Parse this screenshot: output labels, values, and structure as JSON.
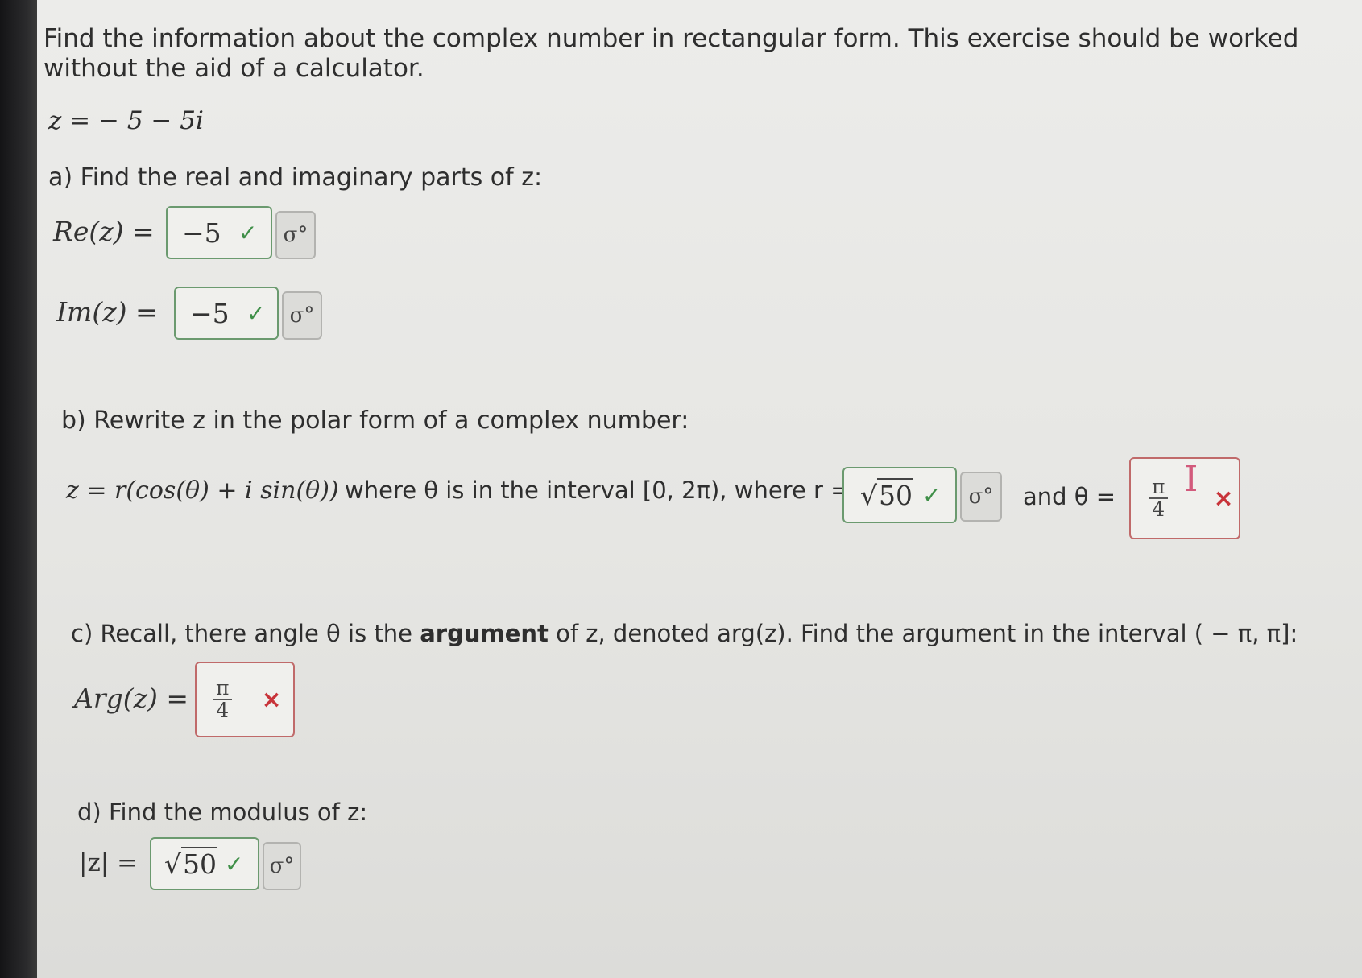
{
  "intro": "Find the information about the complex number in rectangular form. This exercise should be worked without the aid of a calculator.",
  "z_def": "z = − 5 − 5i",
  "part_a": {
    "prompt": "a) Find the real and imaginary parts of z:",
    "re_label": "Re(z) =",
    "re_value": "−5",
    "im_label": "Im(z) =",
    "im_value": "−5"
  },
  "part_b": {
    "prompt": "b) Rewrite z in the polar form of a complex number:",
    "formula": "z = r(cos(θ) + i sin(θ))",
    "where_theta": "where θ is in the interval [0, 2π), where r =",
    "r_value": "50",
    "and_theta": "and θ =",
    "theta_num": "π",
    "theta_den": "4"
  },
  "part_c": {
    "prompt_pre": "c) Recall, there angle θ is the ",
    "prompt_bold": "argument",
    "prompt_post": " of z, denoted arg(z). Find the argument in the interval ( − π, π]:",
    "arg_label": "Arg(z) =",
    "arg_num": "π",
    "arg_den": "4"
  },
  "part_d": {
    "prompt": "d) Find the modulus of z:",
    "mod_label": "|z| =",
    "mod_value": "50"
  },
  "icons": {
    "correct": "✓",
    "incorrect": "×",
    "sqrt": "√",
    "math_keyboard": "σ°",
    "text_cursor": "I"
  },
  "colors": {
    "correct_green": "#3f8f48",
    "incorrect_red": "#c8343a",
    "correct_border": "#6b9a6f",
    "incorrect_border": "#c06a6a"
  }
}
